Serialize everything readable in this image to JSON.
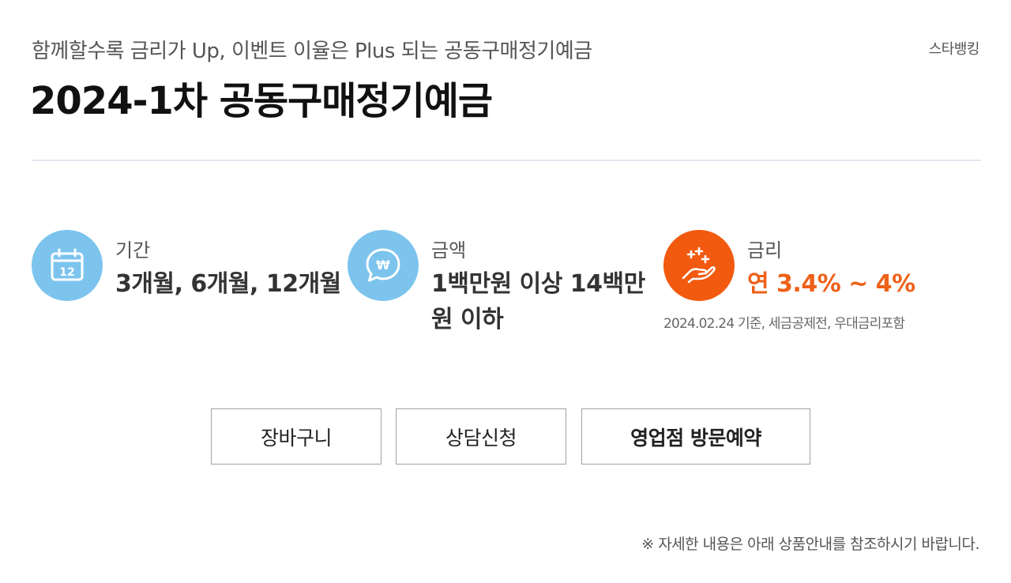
{
  "header": {
    "subtitle": "함께할수록 금리가 Up, 이벤트 이율은 Plus 되는 공동구매정기예금",
    "bank_link": "스타뱅킹",
    "title": "2024-1차 공동구매정기예금"
  },
  "info": {
    "period": {
      "icon": "calendar-icon",
      "label": "기간",
      "value": "3개월, 6개월, 12개월"
    },
    "amount": {
      "icon": "won-chat-bubble-icon",
      "label": "금액",
      "value_line1": "1백만원 이상 14백만",
      "value_line2": "원 이하"
    },
    "rate": {
      "icon": "sparkle-hand-icon",
      "label": "금리",
      "value": "연 3.4% ~ 4%",
      "note": "2024.02.24 기준, 세금공제전, 우대금리포함"
    }
  },
  "actions": {
    "cart": "장바구니",
    "consult": "상담신청",
    "branch_visit": "영업점 방문예약"
  },
  "footnote": "※ 자세한 내용은 아래 상품안내를 참조하시기 바랍니다.",
  "colors": {
    "icon_blue": "#7cc4ee",
    "icon_orange": "#f15a0f",
    "rate_text": "#ee6018",
    "divider": "#e3e8ef"
  }
}
